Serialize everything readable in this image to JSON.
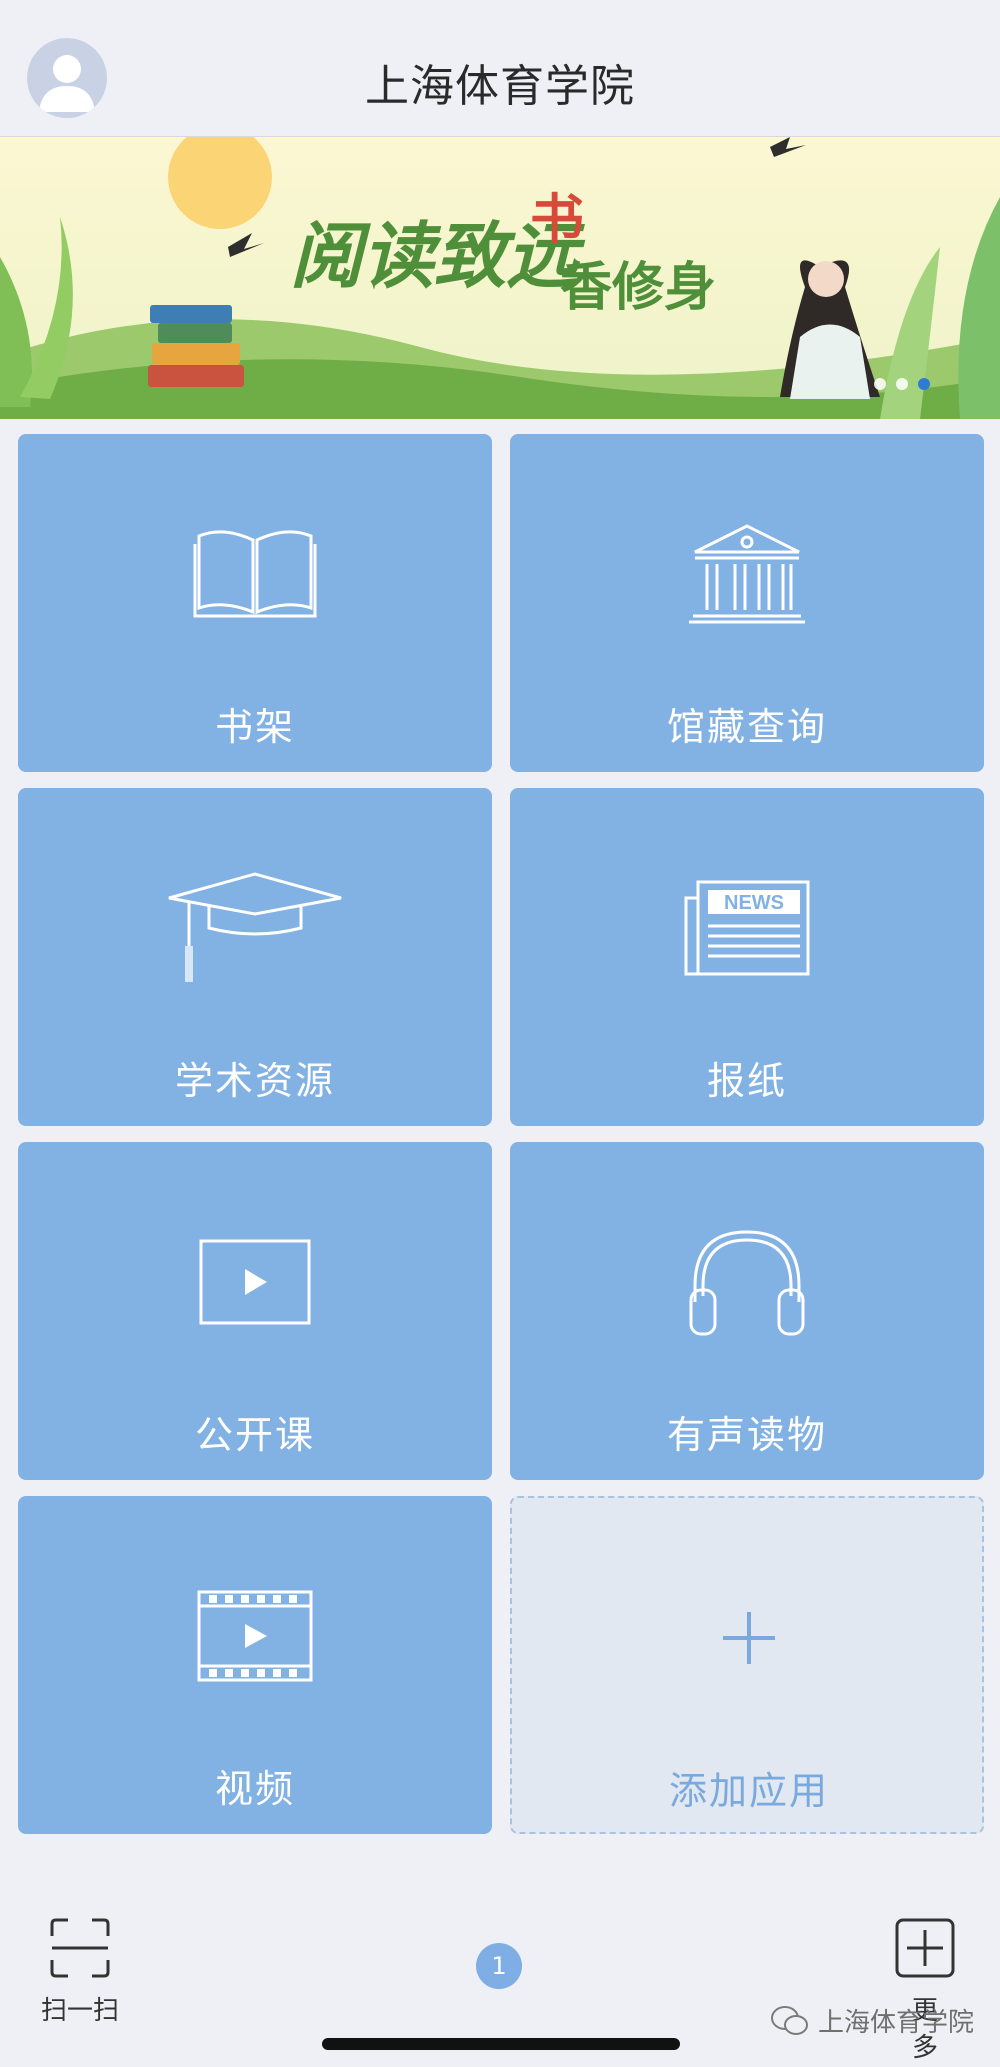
{
  "header": {
    "title": "上海体育学院"
  },
  "banner": {
    "slogan_left": "阅读致远",
    "slogan_right_top": "书",
    "slogan_right_bottom": "香修身",
    "accent": "#f0f6d8"
  },
  "tiles": [
    {
      "label": "书架",
      "icon": "book-open-icon"
    },
    {
      "label": "馆藏查询",
      "icon": "library-building-icon"
    },
    {
      "label": "学术资源",
      "icon": "graduation-cap-icon"
    },
    {
      "label": "报纸",
      "icon": "newspaper-icon",
      "icon_text": "NEWS"
    },
    {
      "label": "公开课",
      "icon": "play-screen-icon"
    },
    {
      "label": "有声读物",
      "icon": "headphones-icon"
    },
    {
      "label": "视频",
      "icon": "film-play-icon"
    },
    {
      "label": "添加应用",
      "icon": "plus-icon"
    }
  ],
  "dock": {
    "scan_label": "扫一扫",
    "page_number": "1",
    "more_label": "更多"
  },
  "watermark": "上海体育学院",
  "colors": {
    "tile": "#82b1e3",
    "add_tile": "#e2e8f1",
    "background": "#eff0f5"
  }
}
